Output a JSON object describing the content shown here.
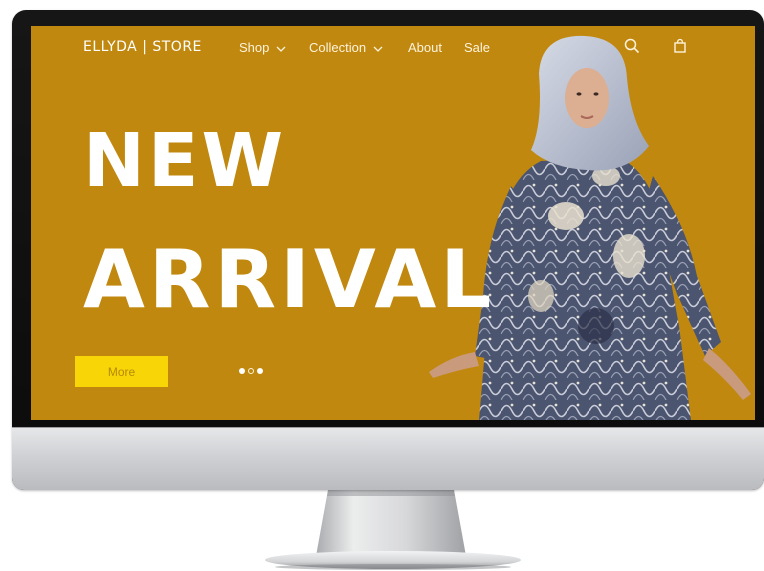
{
  "nav": {
    "brand": "ELLYDA | STORE",
    "items": [
      {
        "label": "Shop",
        "has_dropdown": true
      },
      {
        "label": "Collection",
        "has_dropdown": true
      },
      {
        "label": "About",
        "has_dropdown": false
      },
      {
        "label": "Sale",
        "has_dropdown": false
      }
    ],
    "icons": [
      "search-icon",
      "shopping-bag-icon"
    ]
  },
  "hero": {
    "line1": "NEW",
    "line2": "ARRIVAL",
    "button_label": "More",
    "carousel_dots": 3,
    "active_dot": 3
  },
  "colors": {
    "hero_background": "#c1880f",
    "button_background": "#f7d507",
    "text": "#ffffff"
  }
}
